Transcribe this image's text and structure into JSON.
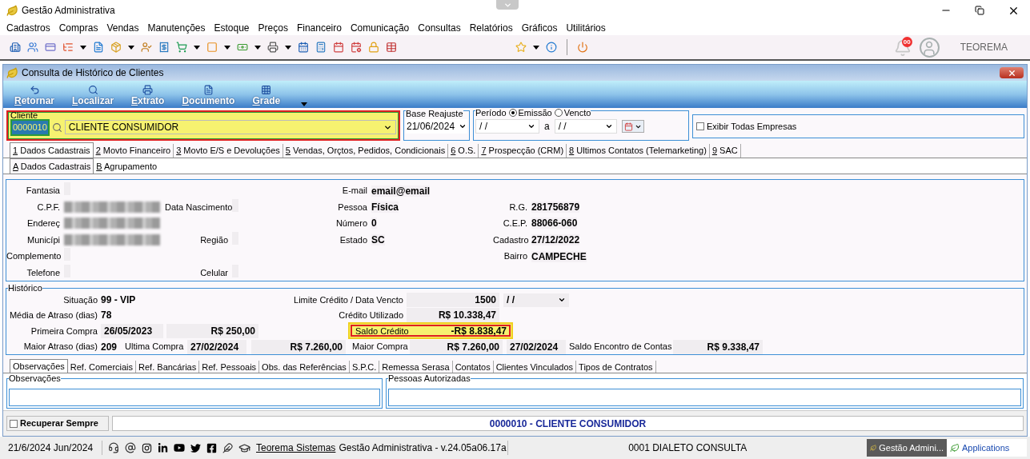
{
  "window": {
    "title": "Gestão Administrativa"
  },
  "menu": [
    "Cadastros",
    "Compras",
    "Vendas",
    "Manutenções",
    "Estoque",
    "Preços",
    "Financeiro",
    "Comunicação",
    "Consultas",
    "Relatórios",
    "Gráficos",
    "Utilitários"
  ],
  "account": {
    "notifications": "00",
    "user": "TEOREMA"
  },
  "child_window": {
    "title": "Consulta de Histórico de Clientes"
  },
  "actions": [
    {
      "label": "Retornar",
      "kind": "back"
    },
    {
      "label": "Localizar",
      "kind": "search"
    },
    {
      "label": "Extrato",
      "kind": "print"
    },
    {
      "label": "Documento",
      "kind": "document"
    },
    {
      "label": "Grade",
      "kind": "grid"
    }
  ],
  "filters": {
    "cliente": {
      "label": "Cliente",
      "code": "0000010",
      "name": "CLIENTE CONSUMIDOR",
      "highlighted": true
    },
    "base_reajuste": {
      "label": "Base Reajuste",
      "value": "21/06/2024"
    },
    "periodo": {
      "label": "Período",
      "options": [
        {
          "label": "Emissão",
          "selected": true
        },
        {
          "label": "Vencto",
          "selected": false
        }
      ],
      "from": "/ /",
      "separator": "a",
      "to": "/ /"
    },
    "all_companies": {
      "label": "Exibir Todas Empresas",
      "checked": false
    }
  },
  "tabs": [
    {
      "label": "1 Dados Cadastrais",
      "selected": true
    },
    {
      "label": "2 Movto Financeiro",
      "selected": false
    },
    {
      "label": "3 Movto E/S e Devoluções",
      "selected": false
    },
    {
      "label": "5 Vendas, Orçtos, Pedidos, Condicionais",
      "selected": false
    },
    {
      "label": "6 O.S.",
      "selected": false
    },
    {
      "label": "7 Prospecção (CRM)",
      "selected": false
    },
    {
      "label": "8 Ultimos Contatos (Telemarketing)",
      "selected": false
    },
    {
      "label": "9 SAC",
      "selected": false
    }
  ],
  "subtabs": [
    {
      "label": "A Dados Cadastrais",
      "selected": true
    },
    {
      "label": "B Agrupamento",
      "selected": false
    }
  ],
  "cadastro": [
    {
      "a": {
        "label": "Fantasia"
      },
      "c": {
        "label": "E-mail",
        "value": "email@email"
      }
    },
    {
      "a": {
        "label": "C.P.F.",
        "redacted": true
      },
      "b": {
        "label": "Data Nascimento"
      },
      "c": {
        "label": "Pessoa",
        "value": "Física"
      },
      "d": {
        "label": "R.G.",
        "value": "281756879"
      }
    },
    {
      "a": {
        "label": "Endereç",
        "redacted": true
      },
      "c": {
        "label": "Número",
        "value": "0"
      },
      "d": {
        "label": "C.E.P.",
        "value": "88066-060"
      }
    },
    {
      "a": {
        "label": "Municípi",
        "redacted": true
      },
      "b": {
        "label": "Região"
      },
      "c": {
        "label": "Estado",
        "value": "SC"
      },
      "d": {
        "label": "Cadastro",
        "value": "27/12/2022"
      }
    },
    {
      "a": {
        "label": "Complemento"
      },
      "d": {
        "label": "Bairro",
        "value": "CAMPECHE"
      }
    },
    {
      "a": {
        "label": "Telefone"
      },
      "b": {
        "label": "Celular"
      }
    }
  ],
  "historico": {
    "label": "Histórico",
    "situacao": {
      "label": "Situação",
      "value": "99 - VIP"
    },
    "limite": {
      "label": "Limite Crédito / Data Vencto",
      "value": "1500",
      "date": "/ /"
    },
    "media_atraso": {
      "label": "Média de Atraso (dias)",
      "value": "78"
    },
    "credito_utilizado": {
      "label": "Crédito Utilizado",
      "value": "R$ 10.338,47"
    },
    "primeira_compra": {
      "label": "Primeira Compra",
      "date": "26/05/2023",
      "value": "R$ 250,00"
    },
    "saldo_credito": {
      "label": "Saldo Crédito",
      "value": "-R$ 8.838,47",
      "highlighted": true
    },
    "maior_atraso": {
      "label": "Maior Atraso (dias)",
      "value": "209"
    },
    "ultima_compra": {
      "label": "Ultima Compra",
      "date": "27/02/2024",
      "value": "R$ 7.260,00"
    },
    "maior_compra": {
      "label": "Maior Compra",
      "value": "R$ 7.260,00",
      "date": "27/02/2024"
    },
    "saldo_encontro": {
      "label": "Saldo Encontro de Contas",
      "value": "R$ 9.338,47"
    }
  },
  "bottom_tabs": [
    {
      "label": "Observações",
      "selected": true
    },
    {
      "label": "Ref. Comerciais",
      "selected": false
    },
    {
      "label": "Ref. Bancárias",
      "selected": false
    },
    {
      "label": "Ref. Pessoais",
      "selected": false
    },
    {
      "label": "Obs. das Referências",
      "selected": false
    },
    {
      "label": "S.P.C.",
      "selected": false
    },
    {
      "label": "Remessa Serasa",
      "selected": false
    },
    {
      "label": "Contatos",
      "selected": false
    },
    {
      "label": "Clientes Vinculados",
      "selected": false
    },
    {
      "label": "Tipos de Contratos",
      "selected": false
    }
  ],
  "groups": [
    "Observações",
    "Pessoas Autorizadas"
  ],
  "footer": {
    "recover": {
      "label": "Recuperar Sempre",
      "checked": false
    },
    "client": "0000010 - CLIENTE CONSUMIDOR"
  },
  "status_bar": {
    "date": "21/6/2024 Jun/2024",
    "link": "Teorema Sistemas",
    "version": "Gestão Administrativa - v.24.05a06.17a",
    "company": "0001 DIALETO CONSULTA",
    "tasks": [
      {
        "label": "Gestão Admini...",
        "selected": true
      },
      {
        "label": "Applications",
        "selected": false
      }
    ]
  }
}
